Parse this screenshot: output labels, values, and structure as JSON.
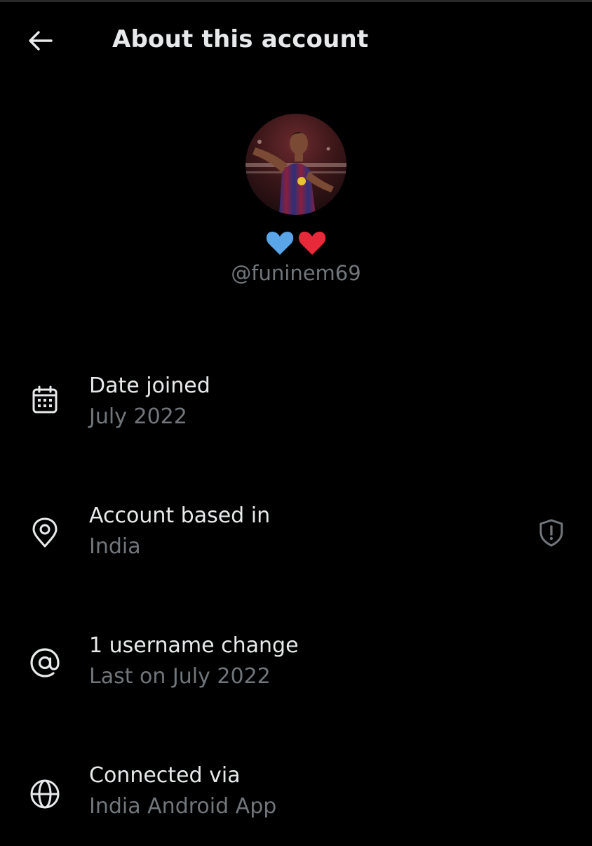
{
  "header": {
    "title": "About this account",
    "back_icon": "arrow-left-icon"
  },
  "profile": {
    "display_name_icons": [
      "blue-heart-icon",
      "red-heart-icon"
    ],
    "handle": "@funinem69"
  },
  "info": {
    "date_joined": {
      "icon": "calendar-icon",
      "label": "Date joined",
      "value": "July 2022"
    },
    "based_in": {
      "icon": "location-pin-icon",
      "label": "Account based in",
      "value": "India",
      "action_icon": "shield-alert-icon"
    },
    "username_changes": {
      "icon": "at-sign-icon",
      "label": "1 username change",
      "value": "Last on July 2022"
    },
    "connected_via": {
      "icon": "globe-icon",
      "label": "Connected via",
      "value": "India Android App"
    }
  },
  "colors": {
    "background": "#000000",
    "primary_text": "#e7e9ea",
    "secondary_text": "#71767b",
    "blue_heart": "#5aa4e8",
    "red_heart": "#e8293a"
  }
}
